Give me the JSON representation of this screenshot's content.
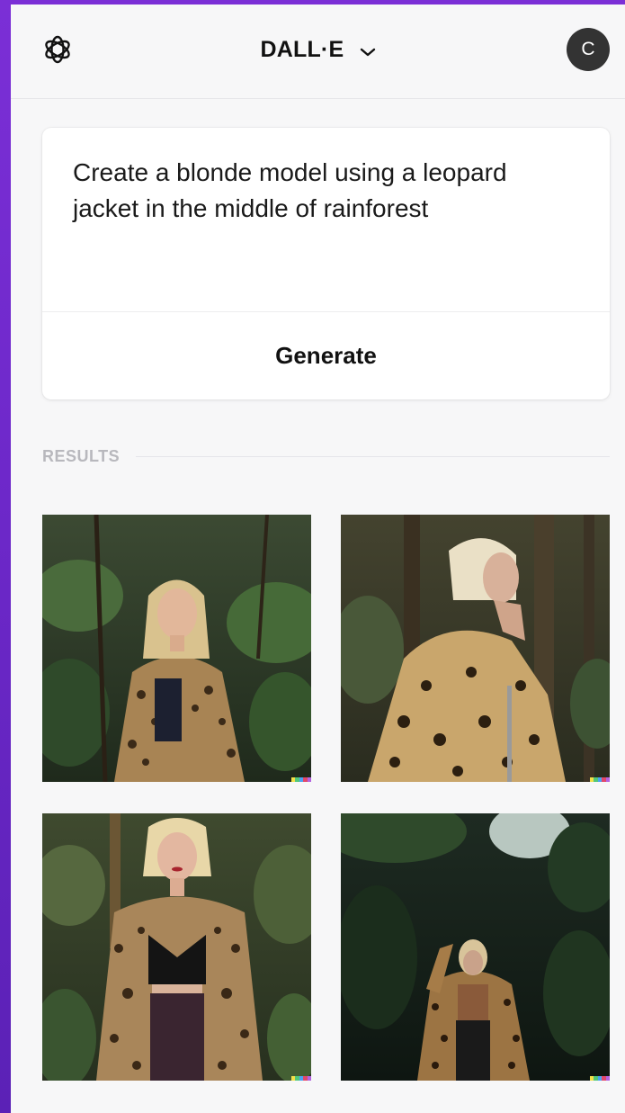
{
  "header": {
    "title": "DALL·E",
    "avatar_initial": "C"
  },
  "prompt": {
    "text": "Create a blonde model using a leopard jacket in the middle of rainforest",
    "generate_label": "Generate"
  },
  "results": {
    "label": "RESULTS"
  },
  "colors": {
    "frame_background": "#6d28c9",
    "app_background": "#f7f7f8",
    "avatar_background": "#333333",
    "signature_strip": [
      "#f2e14a",
      "#52c77a",
      "#4aa3f2",
      "#e1486b",
      "#b463e0"
    ]
  },
  "icons": {
    "logo": "openai-logo-icon",
    "title_menu": "chevron-down-icon"
  }
}
